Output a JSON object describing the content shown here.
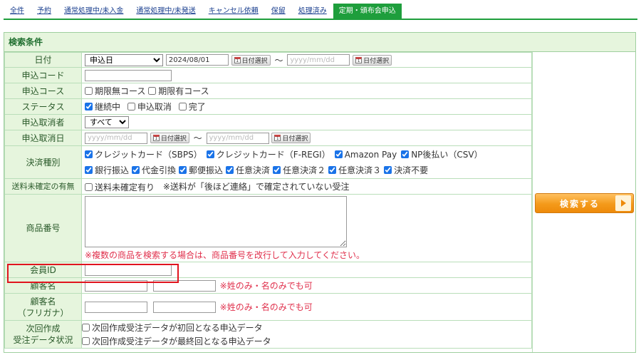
{
  "tabs": [
    "全件",
    "予約",
    "通常処理中/未入金",
    "通常処理中/未発送",
    "キャンセル依頼",
    "保留",
    "処理済み",
    "定期・頒布会申込"
  ],
  "active_tab": 7,
  "panel": {
    "title": "検索条件"
  },
  "rows": {
    "date": {
      "label": "日付",
      "type_value": "申込日",
      "from_value": "2024/08/01",
      "to_placeholder": "yyyy/mm/dd",
      "cal_label": "日付選択",
      "tilde": "〜"
    },
    "code": {
      "label": "申込コード"
    },
    "course": {
      "label": "申込コース",
      "options": [
        "期限無コース",
        "期限有コース"
      ]
    },
    "status": {
      "label": "ステータス",
      "options": [
        {
          "label": "継続中",
          "checked": true
        },
        {
          "label": "申込取消",
          "checked": false
        },
        {
          "label": "完了",
          "checked": false
        }
      ]
    },
    "canceller": {
      "label": "申込取消者",
      "value": "すべて"
    },
    "cancel_date": {
      "label": "申込取消日",
      "from_placeholder": "yyyy/mm/dd",
      "to_placeholder": "yyyy/mm/dd"
    },
    "payment": {
      "label": "決済種別",
      "line1": [
        "クレジットカード（SBPS）",
        "クレジットカード（F-REGI）",
        "Amazon Pay",
        "NP後払い（CSV）"
      ],
      "line2": [
        "銀行振込",
        "代金引換",
        "郵便振込",
        "任意決済",
        "任意決済２",
        "任意決済３",
        "決済不要"
      ]
    },
    "shipping": {
      "label": "送料未確定の有無",
      "option": "送料未確定有り",
      "note": "※送料が「後ほど連絡」で確定されていない受注"
    },
    "product": {
      "label": "商品番号",
      "note": "※複数の商品を検索する場合は、商品番号を改行して入力してください。"
    },
    "member": {
      "label": "会員ID"
    },
    "customer": {
      "label": "顧客名",
      "note": "※姓のみ・名のみでも可"
    },
    "kana": {
      "label_line1": "顧客名",
      "label_line2": "（フリガナ）",
      "note": "※姓のみ・名のみでも可"
    },
    "next": {
      "label_line1": "次回作成",
      "label_line2": "受注データ状況",
      "options": [
        "次回作成受注データが初回となる申込データ",
        "次回作成受注データが最終回となる申込データ"
      ]
    }
  },
  "search_button": "検索する",
  "colors": {
    "tab_active": "#1e9e3c",
    "label_bg": "#e6f5dd",
    "accent_orange": "#f49a1a",
    "highlight_red": "#e0141e"
  }
}
